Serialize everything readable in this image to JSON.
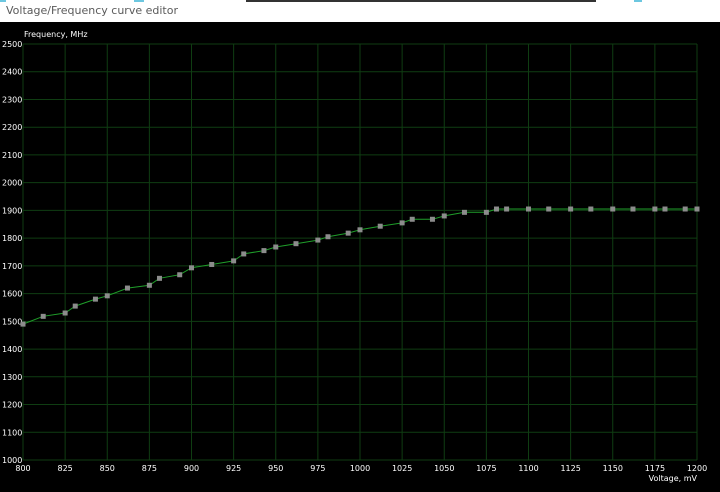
{
  "window": {
    "title": "Voltage/Frequency curve editor"
  },
  "colors": {
    "background": "#000000",
    "grid": "#0f3d12",
    "curve": "#1f9e2a",
    "point": "#8c8c8c",
    "axis_text": "#ffffff"
  },
  "chart_data": {
    "type": "line",
    "ylabel": "Frequency, MHz",
    "xlabel": "Voltage, mV",
    "xlim": [
      800,
      1200
    ],
    "ylim": [
      1000,
      2500
    ],
    "x_ticks": [
      800,
      825,
      850,
      875,
      900,
      925,
      950,
      975,
      1000,
      1025,
      1050,
      1075,
      1100,
      1125,
      1150,
      1175,
      1200
    ],
    "y_ticks": [
      1000,
      1100,
      1200,
      1300,
      1400,
      1500,
      1600,
      1700,
      1800,
      1900,
      2000,
      2100,
      2200,
      2300,
      2400,
      2500
    ],
    "grid": true,
    "series": [
      {
        "x": [
          800,
          812,
          825,
          831,
          843,
          850,
          862,
          875,
          881,
          893,
          900,
          912,
          925,
          931,
          943,
          950,
          962,
          975,
          981,
          993,
          1000,
          1012,
          1025,
          1031,
          1043,
          1050,
          1062,
          1075,
          1081,
          1087,
          1100,
          1112,
          1125,
          1137,
          1150,
          1162,
          1175,
          1181,
          1193,
          1200
        ],
        "y": [
          1490,
          1518,
          1530,
          1555,
          1580,
          1592,
          1620,
          1630,
          1655,
          1668,
          1693,
          1705,
          1718,
          1743,
          1755,
          1768,
          1780,
          1793,
          1805,
          1818,
          1830,
          1843,
          1855,
          1868,
          1868,
          1880,
          1893,
          1893,
          1905,
          1905,
          1905,
          1905,
          1905,
          1905,
          1905,
          1905,
          1905,
          1905,
          1905,
          1905
        ]
      }
    ]
  }
}
